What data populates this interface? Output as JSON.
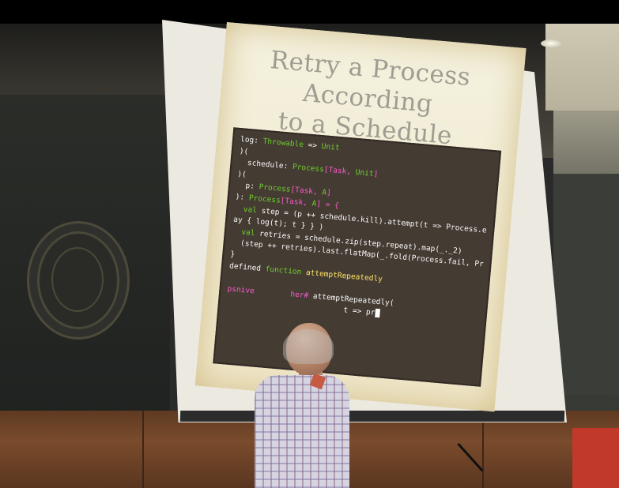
{
  "slide": {
    "title_line1": "Retry a Process According",
    "title_line2": "to a Schedule"
  },
  "terminal": {
    "lines": [
      [
        {
          "t": "log: ",
          "c": "c-white"
        },
        {
          "t": "Throwable",
          "c": "c-green"
        },
        {
          "t": " => ",
          "c": "c-white"
        },
        {
          "t": "Unit",
          "c": "c-green"
        }
      ],
      [
        {
          "t": ")(",
          "c": "c-white"
        }
      ],
      [
        {
          "t": "  schedule: ",
          "c": "c-white"
        },
        {
          "t": "Process",
          "c": "c-green"
        },
        {
          "t": "[Task, ",
          "c": "c-magenta"
        },
        {
          "t": "Unit",
          "c": "c-green"
        },
        {
          "t": "]",
          "c": "c-magenta"
        }
      ],
      [
        {
          "t": ")(",
          "c": "c-white"
        }
      ],
      [
        {
          "t": "  p: ",
          "c": "c-white"
        },
        {
          "t": "Process",
          "c": "c-green"
        },
        {
          "t": "[Task, ",
          "c": "c-magenta"
        },
        {
          "t": "A",
          "c": "c-green"
        },
        {
          "t": "]",
          "c": "c-magenta"
        }
      ],
      [
        {
          "t": "): ",
          "c": "c-white"
        },
        {
          "t": "Process",
          "c": "c-green"
        },
        {
          "t": "[Task, ",
          "c": "c-magenta"
        },
        {
          "t": "A",
          "c": "c-green"
        },
        {
          "t": "] = {",
          "c": "c-magenta"
        }
      ],
      [
        {
          "t": "  ",
          "c": "c-white"
        },
        {
          "t": "val",
          "c": "c-green"
        },
        {
          "t": " step = (p ++ schedule.kill).attempt(t => Process.eval { Task.del",
          "c": "c-white"
        }
      ],
      [
        {
          "t": "ay { log(t); t } } )",
          "c": "c-white"
        }
      ],
      [
        {
          "t": "  ",
          "c": "c-white"
        },
        {
          "t": "val",
          "c": "c-green"
        },
        {
          "t": " retries = schedule.zip(step.repeat).map(_._2)",
          "c": "c-white"
        }
      ],
      [
        {
          "t": "  (step ++ retries).last.flatMap(_.fold(Process.fail, Process.emit))",
          "c": "c-white"
        }
      ],
      [
        {
          "t": "}",
          "c": "c-white"
        }
      ],
      [
        {
          "t": "defined ",
          "c": "c-white"
        },
        {
          "t": "function",
          "c": "c-green"
        },
        {
          "t": " attemptRepeatedly",
          "c": "c-yellow"
        }
      ],
      [
        {
          "t": "",
          "c": "c-white"
        }
      ],
      [
        {
          "t": "psnive",
          "c": "c-magenta"
        },
        {
          "t": "        ",
          "c": "c-white"
        },
        {
          "t": "her# ",
          "c": "c-magenta"
        },
        {
          "t": "attemptRepeatedly(",
          "c": "c-white"
        }
      ],
      [
        {
          "t": "                          t => pr",
          "c": "c-white"
        }
      ]
    ]
  }
}
